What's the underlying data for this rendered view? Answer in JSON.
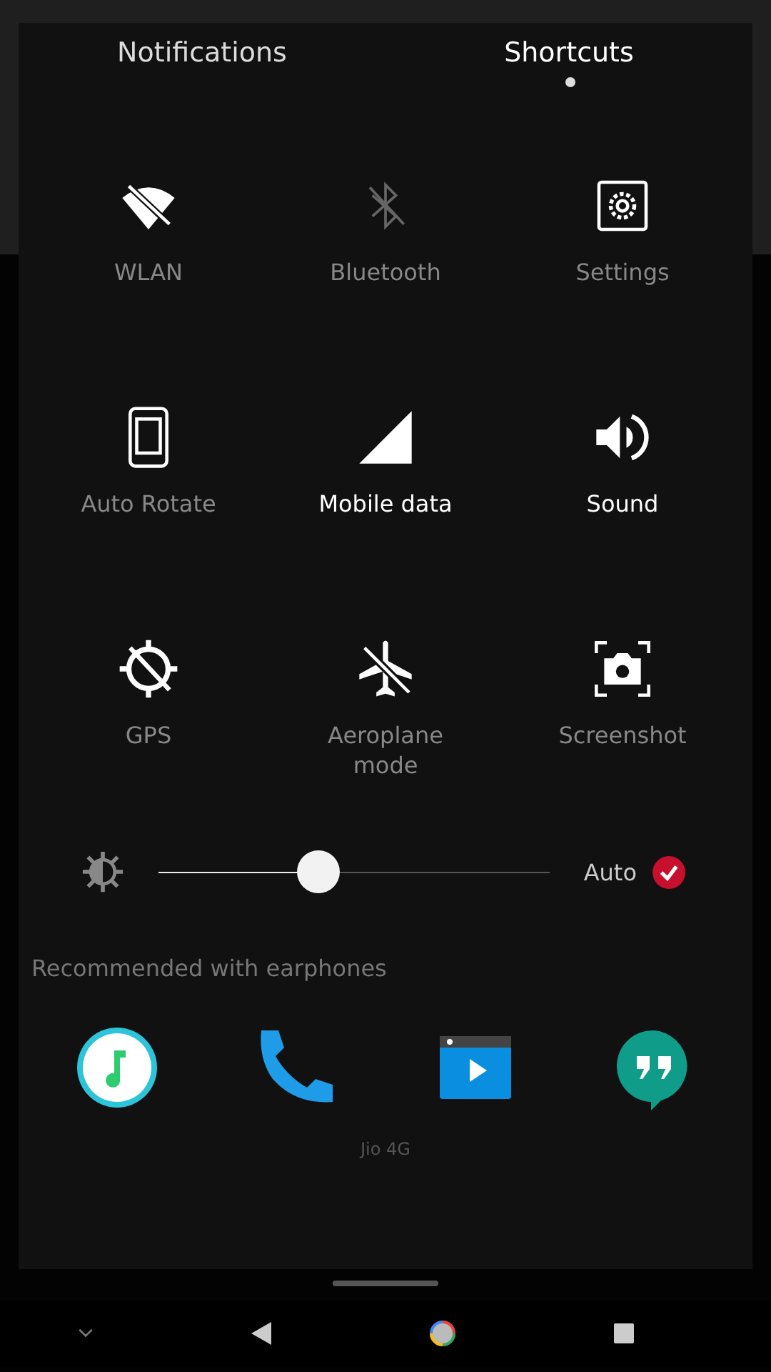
{
  "tabs": [
    {
      "label": "Notifications",
      "selected": false
    },
    {
      "label": "Shortcuts",
      "selected": true
    }
  ],
  "tiles": [
    {
      "kind": "wifi-off",
      "label": "WLAN",
      "on": false
    },
    {
      "kind": "bluetooth",
      "label": "Bluetooth",
      "on": false
    },
    {
      "kind": "settings",
      "label": "Settings",
      "on": false
    },
    {
      "kind": "rotate",
      "label": "Auto Rotate",
      "on": false
    },
    {
      "kind": "signal",
      "label": "Mobile data",
      "on": true
    },
    {
      "kind": "sound",
      "label": "Sound",
      "on": true
    },
    {
      "kind": "gps-off",
      "label": "GPS",
      "on": false
    },
    {
      "kind": "plane-off",
      "label": "Aeroplane mode",
      "on": false
    },
    {
      "kind": "screenshot",
      "label": "Screenshot",
      "on": false
    }
  ],
  "brightness": {
    "level": 0.41,
    "auto_label": "Auto",
    "auto_checked": true
  },
  "recommended": {
    "title": "Recommended with earphones",
    "apps": [
      {
        "kind": "music"
      },
      {
        "kind": "phone"
      },
      {
        "kind": "video"
      },
      {
        "kind": "chat"
      }
    ]
  },
  "carrier": "Jio 4G"
}
